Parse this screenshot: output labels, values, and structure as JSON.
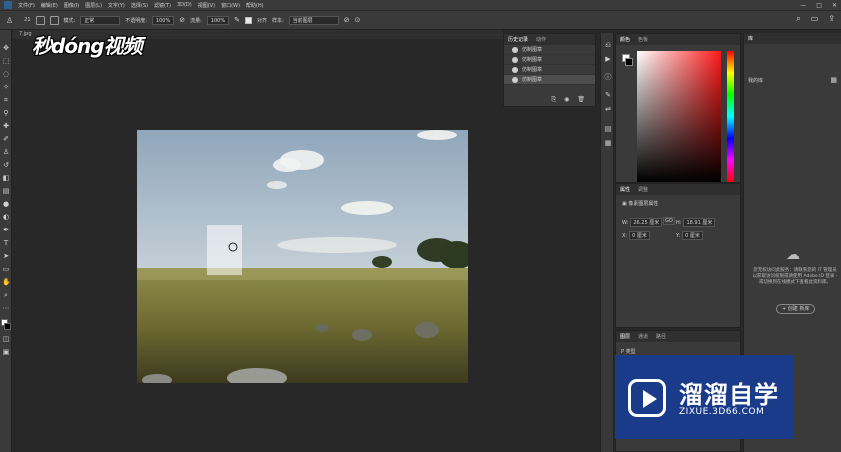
{
  "menu": [
    "文件(F)",
    "编辑(E)",
    "图像(I)",
    "图层(L)",
    "文字(Y)",
    "选择(S)",
    "滤镜(T)",
    "3D(D)",
    "视图(V)",
    "窗口(W)",
    "帮助(H)"
  ],
  "options_bar": {
    "brush_size": "21",
    "mode_label": "模式:",
    "mode_value": "正常",
    "opacity_label": "不透明度:",
    "opacity_value": "100%",
    "flow_label": "流量:",
    "flow_value": "100%",
    "aligned_label": "对齐",
    "sample_label": "样本:",
    "sample_value": "当前图层"
  },
  "document": {
    "tab_title": "7.jpg"
  },
  "video_logo": "秒dóng视频",
  "history_panel": {
    "tabs": [
      "历史记录",
      "动作"
    ],
    "items": [
      "仿制图章",
      "仿制图章",
      "仿制图章",
      "仿制图章"
    ]
  },
  "color_panel": {
    "tabs": [
      "颜色",
      "色板"
    ]
  },
  "properties_panel": {
    "tabs": [
      "属性",
      "调整"
    ],
    "layer_props_label": "像素图层属性",
    "w_label": "W:",
    "w_value": "26.25 厘米",
    "h_label": "H:",
    "h_value": "18.91 厘米",
    "x_label": "X:",
    "x_value": "0 厘米",
    "y_label": "Y:",
    "y_value": "0 厘米",
    "link_label": "GO"
  },
  "layers_panel": {
    "tabs": [
      "图层",
      "通道",
      "路径"
    ],
    "kind_label": "P 类型"
  },
  "library_panel": {
    "title": "库",
    "dropdown": "我的库",
    "message": "您无权访问此服务：请联系您的 IT 管理员以获取访问权限或请使用 Adobe ID 登录 - 或切换到在线模式下查看此资料库。",
    "create_button": "+ 创建 新库"
  },
  "brand": {
    "title": "溜溜自学",
    "url": "ZIXUE.3D66.COM"
  }
}
